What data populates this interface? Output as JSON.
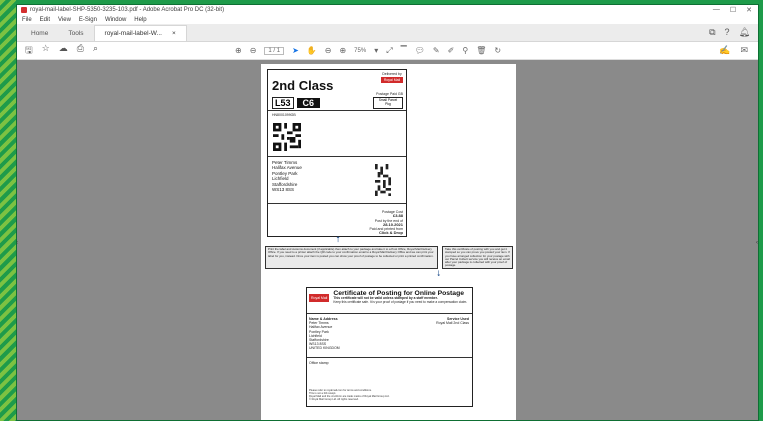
{
  "window": {
    "title": "royal-mail-label-SHP-5350-3235-103.pdf - Adobe Acrobat Pro DC (32-bit)",
    "controls": [
      "—",
      "☐",
      "✕"
    ]
  },
  "menu": [
    "File",
    "Edit",
    "View",
    "E-Sign",
    "Window",
    "Help"
  ],
  "tabs": {
    "home": "Home",
    "tools": "Tools",
    "doc": "royal-mail-label-W...",
    "doc_close": "×"
  },
  "toolbar": {
    "page_current": "1",
    "page_total": "/ 1",
    "zoom": "75%"
  },
  "label": {
    "service_class": "2nd Class",
    "delivered_by": "Delivered by",
    "carrier": "Royal Mail",
    "postage_paid": "Postage Paid GB",
    "code1": "L53",
    "code2": "C6",
    "class_box_title": "Small Parcel",
    "class_box_value": "Pkg",
    "tracking": "HN8001099GB",
    "address": [
      "Peter Timms",
      "Halifax Avenue",
      "Pontley Park",
      "Lichfield",
      "Staffordshire",
      "WS13 8SS"
    ],
    "postage_cost_label": "Postage Cost",
    "postage_cost": "£3.88",
    "post_by_label": "Post by the end of",
    "post_by": "28.10.2021",
    "paid_label": "Paid and printed from",
    "paid_via": "Click & Drop"
  },
  "instructions": {
    "left": "Print the label and customs document (if applicable) then attach to your package and take it to a Post Office, Royal Mail Delivery Office. If you need to a printer attach the QR code to your confirmation email to a Royal Mail Delivery Office and we can print your label for you, instead. Once your item is posted you can show your proof of postage to be collected or print a printed confirmation.",
    "right": "Take this certificate of posting with you and get it stamped so you can prove you posted your item. If you have arranged collection for your postage with our Parcel Collect service you will receive an email after your package is collected with your proof of postage."
  },
  "certificate": {
    "logo": "Royal Mail",
    "title": "Certificate of Posting for Online Postage",
    "subtitle_bold": "This certificate will not be valid unless stamped by a staff member.",
    "subtitle": "Keep this certificate safe. It is your proof of postage if you need to make a compensation claim.",
    "name_header": "Name & Address",
    "name_lines": [
      "Peter Timms",
      "Halifax Avenue",
      "Pontley Park",
      "Lichfield",
      "Staffordshire",
      "WS13 8SS",
      "UNITED KINGDOM"
    ],
    "service_header": "Service Used",
    "service": "Royal Mail 2nd Class",
    "office_stamp": "Office stamp",
    "footer": [
      "Please refer to royalmail.com for terms and conditions.",
      "This is not a bill receipt.",
      "Royal Mail and the cruciform are trade marks of Royal Mail Group Ltd.",
      "© Royal Mail Group Ltd. All rights reserved."
    ]
  }
}
